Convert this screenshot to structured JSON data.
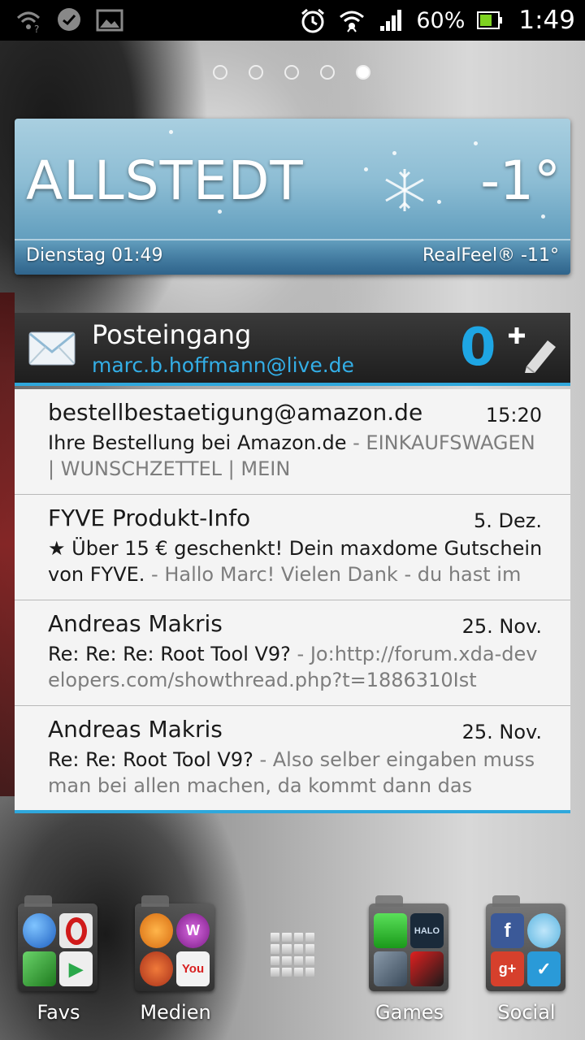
{
  "status_bar": {
    "battery": "60%",
    "time": "1:49",
    "left_icons": [
      "wifi-question-icon",
      "messenger-icon",
      "gallery-icon"
    ],
    "right_icons": [
      "alarm-icon",
      "hotspot-icon",
      "signal-icon",
      "battery-icon"
    ]
  },
  "home_pages": {
    "count": 5,
    "active_index": 4
  },
  "weather": {
    "city": "ALLSTEDT",
    "temperature": "-1°",
    "day_time": "Dienstag 01:49",
    "realfeel": "RealFeel® -11°",
    "condition_icon": "snowflake-icon"
  },
  "mail": {
    "title": "Posteingang",
    "account": "marc.b.hoffmann@live.de",
    "unread_count": "0",
    "items": [
      {
        "sender": "bestellbestaetigung@amazon.de",
        "date": "15:20",
        "subject": "Ihre Bestellung bei Amazon.de",
        "separator": " - ",
        "body": "EINKAUFSWAGEN | WUNSCHZETTEL | MEIN"
      },
      {
        "sender": "FYVE Produkt-Info",
        "date": "5. Dez.",
        "subject": "★ Über 15 € geschenkt! Dein maxdome Gutschein von FYVE.",
        "separator": " - ",
        "body": "Hallo Marc! Vielen Dank - du hast im"
      },
      {
        "sender": "Andreas Makris",
        "date": "25. Nov.",
        "subject": "Re: Re: Re: Root Tool V9?",
        "separator": " - ",
        "body": "Jo:http://forum.xda-developers.com/showthread.php?t=1886310Ist"
      },
      {
        "sender": "Andreas Makris",
        "date": "25. Nov.",
        "subject": "Re: Re: Root Tool V9?",
        "separator": " - ",
        "body": "Also selber eingaben muss man bei allen machen, da kommt dann das"
      }
    ]
  },
  "dock": {
    "folders": [
      {
        "label": "Favs",
        "apps": [
          {
            "icon": "browser-icon",
            "glyph": "",
            "color": "#2a6fd0"
          },
          {
            "icon": "opera-icon",
            "glyph": "O",
            "color": "#d01a1a"
          },
          {
            "icon": "green-app-icon",
            "glyph": "",
            "color": "#2f9a2f"
          },
          {
            "icon": "play-store-icon",
            "glyph": "▶",
            "color": "#e8e8e8"
          }
        ]
      },
      {
        "label": "Medien",
        "apps": [
          {
            "icon": "album-icon",
            "glyph": "",
            "color": "#e68a1a"
          },
          {
            "icon": "walkman-icon",
            "glyph": "W",
            "color": "#9a2aa0"
          },
          {
            "icon": "movies-icon",
            "glyph": "",
            "color": "#c8401a"
          },
          {
            "icon": "youtube-icon",
            "glyph": "You",
            "color": "#d82020"
          }
        ]
      },
      {
        "label": "Games",
        "apps": [
          {
            "icon": "xbox-icon",
            "glyph": "",
            "color": "#2ab82a"
          },
          {
            "icon": "halo-icon",
            "glyph": "HALO",
            "color": "#1a3a4a"
          },
          {
            "icon": "racing-game-icon",
            "glyph": "",
            "color": "#5a6a7a"
          },
          {
            "icon": "action-game-icon",
            "glyph": "",
            "color": "#b01818"
          }
        ]
      },
      {
        "label": "Social",
        "apps": [
          {
            "icon": "facebook-icon",
            "glyph": "f",
            "color": "#3b5998"
          },
          {
            "icon": "chat-bird-icon",
            "glyph": "",
            "color": "#6ac0e8"
          },
          {
            "icon": "google-plus-icon",
            "glyph": "g+",
            "color": "#d6402c"
          },
          {
            "icon": "check-app-icon",
            "glyph": "✓",
            "color": "#2a9ad8"
          }
        ]
      }
    ],
    "app_drawer_icon": "app-grid-icon"
  }
}
